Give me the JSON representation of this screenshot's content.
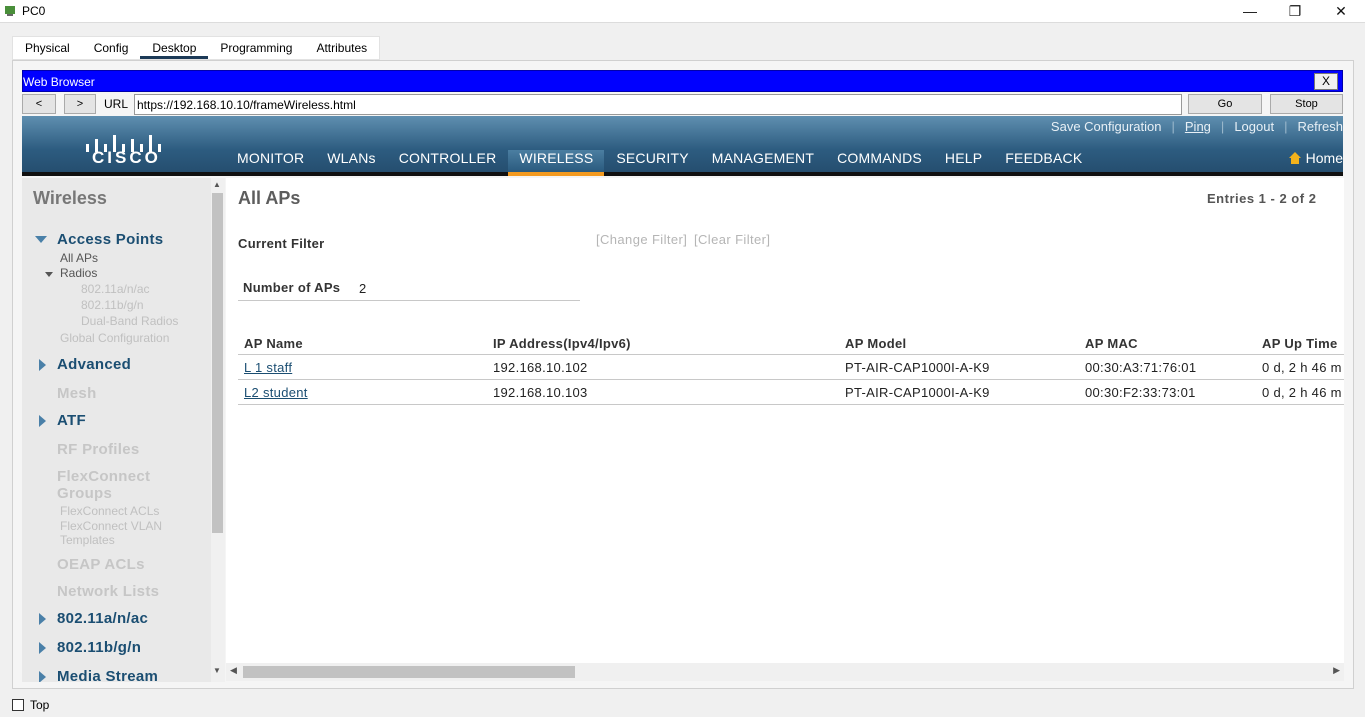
{
  "window": {
    "title": "PC0",
    "minimize": "—",
    "restore": "❐",
    "close": "✕"
  },
  "tabs": [
    "Physical",
    "Config",
    "Desktop",
    "Programming",
    "Attributes"
  ],
  "browser": {
    "title": "Web Browser",
    "close_label": "X",
    "back_label": "<",
    "forward_label": ">",
    "url_label": "URL",
    "url_value": "https://192.168.10.10/frameWireless.html",
    "go_label": "Go",
    "stop_label": "Stop"
  },
  "header": {
    "logo_text": "CISCO",
    "top_links": [
      "Save Configuration",
      "Ping",
      "Logout",
      "Refresh"
    ],
    "menu": [
      "MONITOR",
      "WLANs",
      "CONTROLLER",
      "WIRELESS",
      "SECURITY",
      "MANAGEMENT",
      "COMMANDS",
      "HELP",
      "FEEDBACK"
    ],
    "active_menu": "WIRELESS",
    "home_label": "Home",
    "active_color": "#f39a20"
  },
  "sidebar": {
    "heading": "Wireless",
    "access_points": "Access Points",
    "all_aps": "All APs",
    "radios": "Radios",
    "radio_items": [
      "802.11a/n/ac",
      "802.11b/g/n",
      "Dual-Band Radios"
    ],
    "global_config": "Global Configuration",
    "advanced": "Advanced",
    "mesh": "Mesh",
    "atf": "ATF",
    "rf_profiles": "RF Profiles",
    "flexconnect_groups": "FlexConnect Groups",
    "flexconnect_acls": "FlexConnect ACLs",
    "flexconnect_vlan": "FlexConnect VLAN Templates",
    "oeap_acls": "OEAP ACLs",
    "network_lists": "Network Lists",
    "band_a": "802.11a/n/ac",
    "band_b": "802.11b/g/n",
    "media_stream": "Media Stream"
  },
  "main": {
    "title": "All APs",
    "entries": "Entries 1 - 2 of 2",
    "current_filter_label": "Current Filter",
    "change_filter": "[Change Filter]",
    "clear_filter": "[Clear Filter]",
    "number_of_aps_label": "Number of APs",
    "number_of_aps": "2",
    "columns": [
      "AP Name",
      "IP Address(Ipv4/Ipv6)",
      "AP Model",
      "AP MAC",
      "AP Up Time"
    ],
    "rows": [
      {
        "name": "L 1 staff",
        "ip": "192.168.10.102",
        "model": "PT-AIR-CAP1000I-A-K9",
        "mac": "00:30:A3:71:76:01",
        "uptime": "0 d, 2 h 46 m"
      },
      {
        "name": "L2 student",
        "ip": "192.168.10.103",
        "model": "PT-AIR-CAP1000I-A-K9",
        "mac": "00:30:F2:33:73:01",
        "uptime": "0 d, 2 h 46 m"
      }
    ]
  },
  "footer": {
    "top_label": "Top"
  }
}
